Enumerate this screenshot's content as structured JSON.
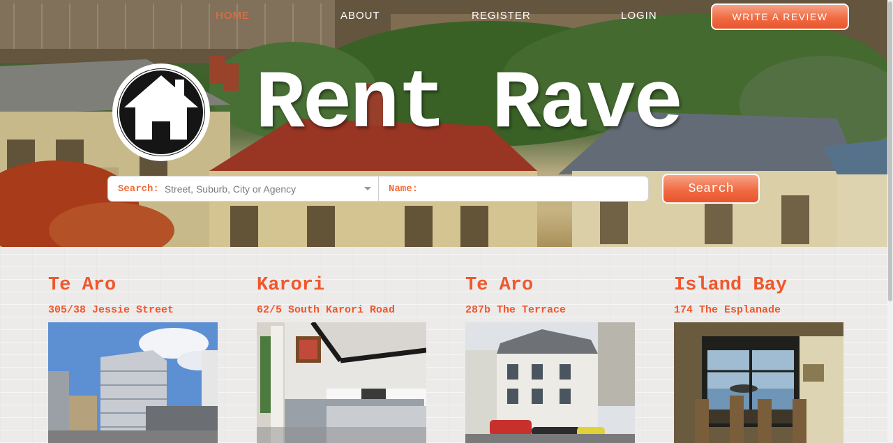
{
  "nav": {
    "items": [
      {
        "label": "HOME",
        "active": true
      },
      {
        "label": "ABOUT",
        "active": false
      },
      {
        "label": "REGISTER",
        "active": false
      },
      {
        "label": "LOGIN",
        "active": false
      }
    ],
    "cta_label": "WRITE A REVIEW"
  },
  "brand": {
    "title": "Rent Rave",
    "logo_icon": "house-icon"
  },
  "search": {
    "location_label": "Search:",
    "location_placeholder": "Street, Suburb, City or Agency",
    "name_label": "Name:",
    "name_value": "",
    "button_label": "Search"
  },
  "listings": [
    {
      "suburb": "Te Aro",
      "address": "305/38 Jessie Street",
      "photo": "apartment-building-photo"
    },
    {
      "suburb": "Karori",
      "address": "62/5 South Karori Road",
      "photo": "bedroom-photo"
    },
    {
      "suburb": "Te Aro",
      "address": "287b The Terrace",
      "photo": "townhouse-photo"
    },
    {
      "suburb": "Island Bay",
      "address": "174 The Esplanade",
      "photo": "dining-room-sea-view-photo"
    }
  ],
  "colors": {
    "accent": "#f26b3a",
    "accent_text": "#f0572c",
    "page_bg": "#ecebea",
    "white": "#ffffff"
  }
}
